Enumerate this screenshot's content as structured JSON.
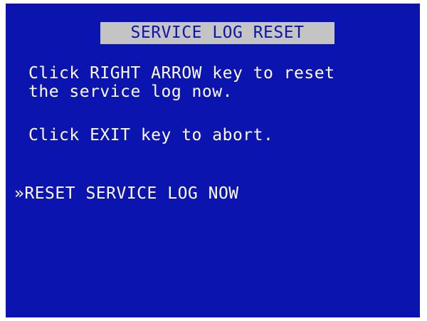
{
  "screen": {
    "title": "SERVICE LOG RESET",
    "instructions": [
      "Click RIGHT ARROW key to reset",
      "the service log now.",
      "Click EXIT key to abort."
    ],
    "menu": {
      "selected_marker": "»",
      "item_label": "RESET SERVICE LOG NOW"
    }
  },
  "colors": {
    "background": "#0c14b0",
    "title_bar": "#c4c4c4",
    "text": "#ffffff"
  }
}
